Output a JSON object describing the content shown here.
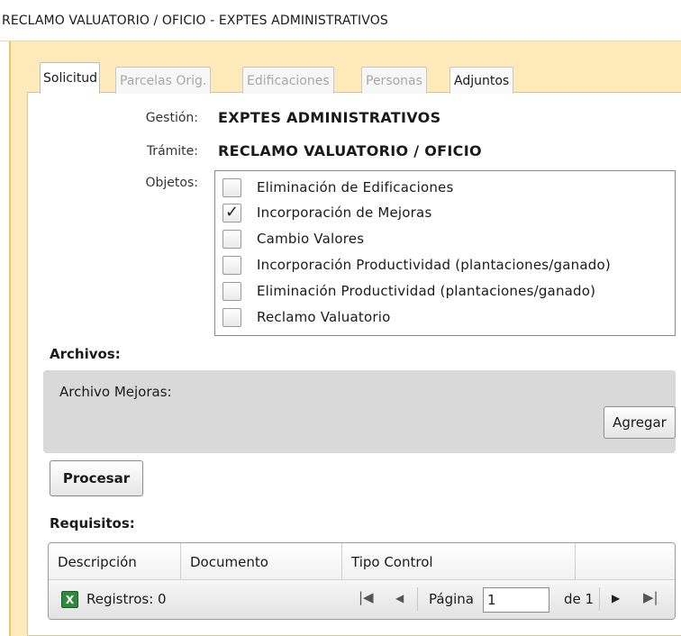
{
  "window": {
    "title": "RECLAMO VALUATORIO / OFICIO  -  EXPTES ADMINISTRATIVOS"
  },
  "tabs": [
    {
      "label": "Solicitud",
      "state": "active"
    },
    {
      "label": "Parcelas Orig.",
      "state": "disabled"
    },
    {
      "label": "Edificaciones",
      "state": "disabled"
    },
    {
      "label": "Personas",
      "state": "disabled"
    },
    {
      "label": "Adjuntos",
      "state": "enabled"
    }
  ],
  "form": {
    "gestion_label": "Gestión:",
    "gestion_value": "EXPTES ADMINISTRATIVOS",
    "tramite_label": "Trámite:",
    "tramite_value": "RECLAMO VALUATORIO / OFICIO",
    "objetos_label": "Objetos:",
    "objetos": [
      {
        "label": "Eliminación de Edificaciones",
        "checked": false
      },
      {
        "label": "Incorporación de Mejoras",
        "checked": true
      },
      {
        "label": "Cambio Valores",
        "checked": false
      },
      {
        "label": "Incorporación Productividad (plantaciones/ganado)",
        "checked": false
      },
      {
        "label": "Eliminación Productividad (plantaciones/ganado)",
        "checked": false
      },
      {
        "label": "Reclamo Valuatorio",
        "checked": false
      }
    ]
  },
  "archivos": {
    "title": "Archivos:",
    "item_label": "Archivo Mejoras:",
    "add_button": "Agregar"
  },
  "actions": {
    "procesar": "Procesar"
  },
  "requisitos": {
    "title": "Requisitos:",
    "columns": [
      "Descripción",
      "Documento",
      "Tipo Control",
      ""
    ],
    "footer": {
      "registros_label": "Registros: 0",
      "pagina_label": "Página",
      "pagina_value": "1",
      "de_label": "de 1"
    }
  },
  "icons": {
    "excel": "excel-export-icon",
    "check": "checkmark-icon",
    "first": "first-page-icon",
    "prev": "previous-page-icon",
    "next": "next-page-icon",
    "last": "last-page-icon"
  },
  "colors": {
    "panel_background": "#fde9ba",
    "panel_border": "#f0c468",
    "section_background": "#d9d9d9"
  }
}
